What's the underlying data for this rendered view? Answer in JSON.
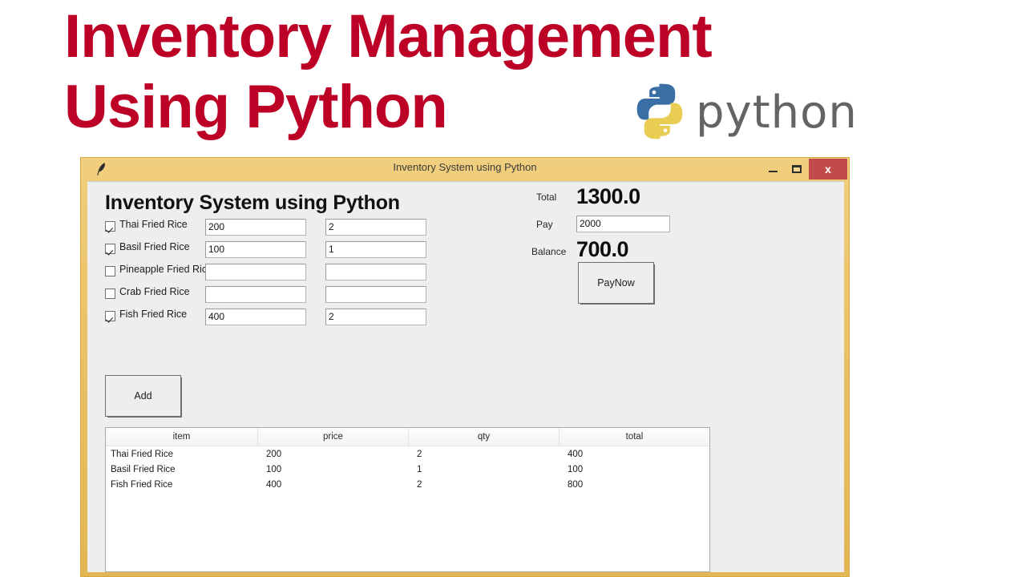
{
  "banner": {
    "title": "Inventory Management\nUsing Python",
    "python_wordmark": "python",
    "logo_icon": "python-logo-icon",
    "title_color": "#bd0026"
  },
  "window": {
    "titlebar": {
      "icon": "feather-icon",
      "title": "Inventory System using Python",
      "minimize": "–",
      "maximize": "☐",
      "close": "x",
      "close_color": "#c34a4a",
      "frame_color": "#e6b94f"
    },
    "app_heading": "Inventory System using Python",
    "items": [
      {
        "label": "Thai Fried Rice",
        "checked": true,
        "price": "200",
        "qty": "2"
      },
      {
        "label": "Basil Fried Rice",
        "checked": true,
        "price": "100",
        "qty": "1"
      },
      {
        "label": "Pineapple Fried Rice",
        "checked": false,
        "price": "",
        "qty": ""
      },
      {
        "label": "Crab Fried Rice",
        "checked": false,
        "price": "",
        "qty": ""
      },
      {
        "label": "Fish Fried Rice",
        "checked": true,
        "price": "400",
        "qty": "2"
      }
    ],
    "summary": {
      "total_label": "Total",
      "total_value": "1300.0",
      "pay_label": "Pay",
      "pay_value": "2000",
      "balance_label": "Balance",
      "balance_value": "700.0",
      "paynow_label": "PayNow"
    },
    "add_label": "Add",
    "table": {
      "columns": [
        "item",
        "price",
        "qty",
        "total"
      ],
      "rows": [
        [
          "Thai Fried Rice",
          "200",
          "2",
          "400"
        ],
        [
          "Basil Fried Rice",
          "100",
          "1",
          "100"
        ],
        [
          "Fish Fried Rice",
          "400",
          "2",
          "800"
        ]
      ]
    }
  }
}
